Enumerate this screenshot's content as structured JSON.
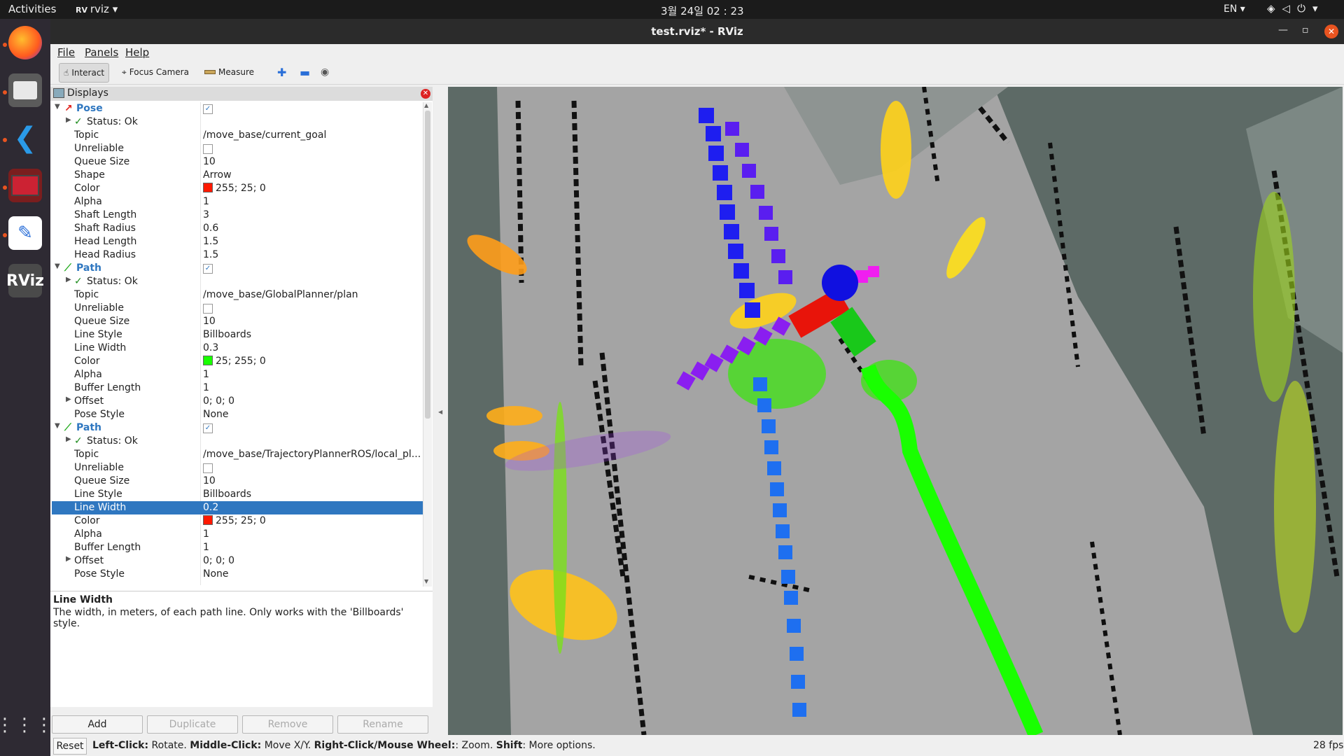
{
  "topbar": {
    "activities": "Activities",
    "app": "rviz",
    "clock": "3월 24일  02 : 23",
    "lang": "EN"
  },
  "dock": {
    "items": [
      "firefox-icon",
      "files-icon",
      "vscode-icon",
      "terminal-icon",
      "text-editor-icon",
      "rviz-icon",
      "app-grid-icon"
    ]
  },
  "window": {
    "title": "test.rviz* - RViz"
  },
  "menu": {
    "file": "File",
    "panels": "Panels",
    "help": "Help"
  },
  "toolbar": {
    "interact": "Interact",
    "focus": "Focus Camera",
    "measure": "Measure"
  },
  "displays": {
    "title": "Displays",
    "pose": {
      "name": "Pose",
      "status": "Status: Ok",
      "topic_label": "Topic",
      "topic": "/move_base/current_goal",
      "unreliable_label": "Unreliable",
      "queue_label": "Queue Size",
      "queue": "10",
      "shape_label": "Shape",
      "shape": "Arrow",
      "color_label": "Color",
      "color": "255; 25; 0",
      "alpha_label": "Alpha",
      "alpha": "1",
      "shaft_length_label": "Shaft Length",
      "shaft_length": "3",
      "shaft_radius_label": "Shaft Radius",
      "shaft_radius": "0.6",
      "head_length_label": "Head Length",
      "head_length": "1.5",
      "head_radius_label": "Head Radius",
      "head_radius": "1.5"
    },
    "path1": {
      "name": "Path",
      "status": "Status: Ok",
      "topic_label": "Topic",
      "topic": "/move_base/GlobalPlanner/plan",
      "unreliable_label": "Unreliable",
      "queue_label": "Queue Size",
      "queue": "10",
      "line_style_label": "Line Style",
      "line_style": "Billboards",
      "line_width_label": "Line Width",
      "line_width": "0.3",
      "color_label": "Color",
      "color": "25; 255; 0",
      "alpha_label": "Alpha",
      "alpha": "1",
      "buffer_label": "Buffer Length",
      "buffer": "1",
      "offset_label": "Offset",
      "offset": "0; 0; 0",
      "pose_style_label": "Pose Style",
      "pose_style": "None"
    },
    "path2": {
      "name": "Path",
      "status": "Status: Ok",
      "topic_label": "Topic",
      "topic": "/move_base/TrajectoryPlannerROS/local_pl...",
      "unreliable_label": "Unreliable",
      "queue_label": "Queue Size",
      "queue": "10",
      "line_style_label": "Line Style",
      "line_style": "Billboards",
      "line_width_label": "Line Width",
      "line_width": "0.2",
      "color_label": "Color",
      "color": "255; 25; 0",
      "alpha_label": "Alpha",
      "alpha": "1",
      "buffer_label": "Buffer Length",
      "buffer": "1",
      "offset_label": "Offset",
      "offset": "0; 0; 0",
      "pose_style_label": "Pose Style",
      "pose_style": "None"
    }
  },
  "description": {
    "title": "Line Width",
    "body": "The width, in meters, of each path line. Only works with the 'Billboards' style."
  },
  "buttons": {
    "add": "Add",
    "duplicate": "Duplicate",
    "remove": "Remove",
    "rename": "Rename"
  },
  "statusbar": {
    "reset": "Reset",
    "left_click": "Left-Click:",
    "left_click_desc": " Rotate. ",
    "middle_click": "Middle-Click:",
    "middle_click_desc": " Move X/Y. ",
    "right_click": "Right-Click/Mouse Wheel:",
    "right_click_desc": ": Zoom. ",
    "shift": "Shift",
    "shift_desc": ": More options.",
    "fps": "28 fps"
  },
  "colors": {
    "pose": "#ff1900",
    "path1": "#19ff00",
    "path2": "#ff1900",
    "selection": "#2f77c0",
    "ubuntu_orange": "#e95420"
  }
}
